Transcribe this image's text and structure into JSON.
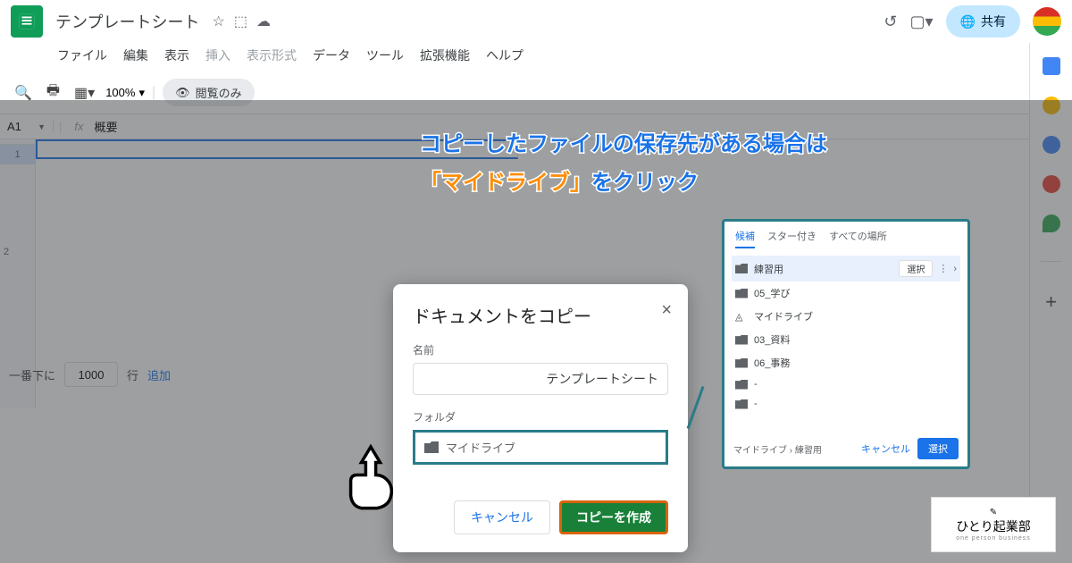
{
  "header": {
    "doc_title": "テンプレートシート",
    "share_label": "共有"
  },
  "menu": {
    "file": "ファイル",
    "edit": "編集",
    "view": "表示",
    "insert": "挿入",
    "format": "表示形式",
    "data": "データ",
    "tools": "ツール",
    "extensions": "拡張機能",
    "help": "ヘルプ"
  },
  "toolbar": {
    "zoom": "100%",
    "view_only": "閲覧のみ"
  },
  "cellref": {
    "ref": "A1",
    "content": "概要"
  },
  "rows": {
    "r1": "1",
    "r2": "2"
  },
  "bottom": {
    "prefix": "一番下に",
    "value": "1000",
    "suffix": "行",
    "add": "追加"
  },
  "dialog": {
    "title": "ドキュメントをコピー",
    "name_label": "名前",
    "name_value": "テンプレートシート",
    "folder_label": "フォルダ",
    "folder_value": "マイドライブ",
    "cancel": "キャンセル",
    "confirm": "コピーを作成"
  },
  "picker": {
    "tabs": {
      "suggested": "候補",
      "starred": "スター付き",
      "all": "すべての場所"
    },
    "sel_badge": "選択",
    "items": [
      "練習用",
      "05_学び",
      "マイドライブ",
      "03_資料",
      "06_事務"
    ],
    "breadcrumb": "マイドライブ  ›  練習用",
    "cancel": "キャンセル",
    "select": "選択"
  },
  "annotation": {
    "line1": "コピーしたファイルの保存先がある場合は",
    "line2a": "「マイドライブ」",
    "line2b": "をクリック"
  },
  "brand": {
    "name": "ひとり起業部",
    "sub": "one person business"
  }
}
